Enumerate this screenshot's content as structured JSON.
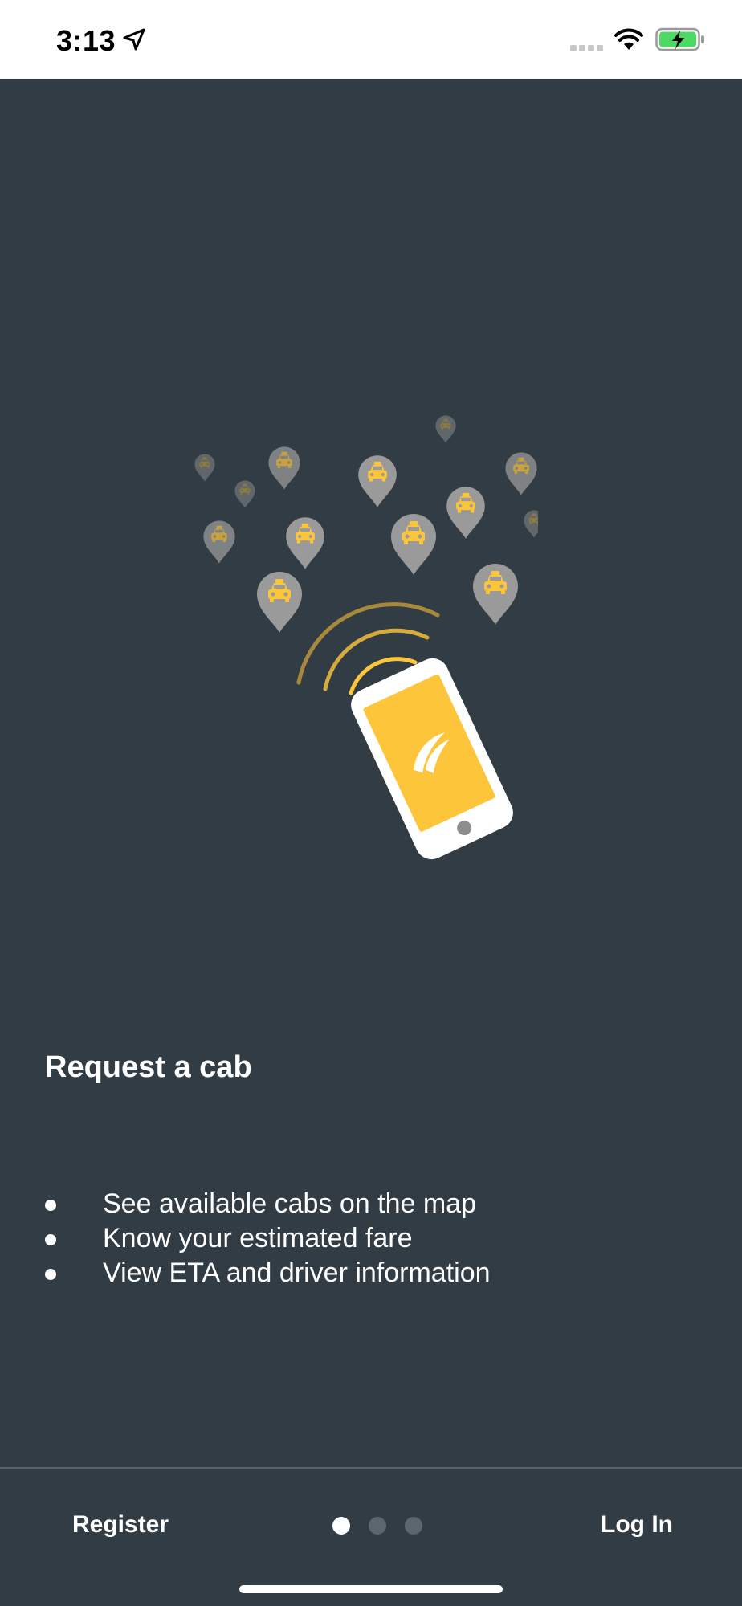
{
  "status_bar": {
    "time": "3:13"
  },
  "onboarding": {
    "title": "Request a cab",
    "features": [
      "See available cabs on the map",
      "Know your estimated fare",
      "View ETA and driver information"
    ]
  },
  "footer": {
    "register_label": "Register",
    "login_label": "Log In",
    "page_count": 3,
    "active_page": 1
  },
  "colors": {
    "background": "#313c44",
    "accent_yellow": "#fcc53a",
    "pin_gray": "#9a9a9a",
    "status_bar_bg": "#ffffff",
    "battery_green": "#4cd964"
  },
  "icons": {
    "illustration": "phone-hailing-taxis-illustration",
    "location": "location-arrow-icon",
    "wifi": "wifi-icon",
    "battery": "battery-charging-icon"
  }
}
